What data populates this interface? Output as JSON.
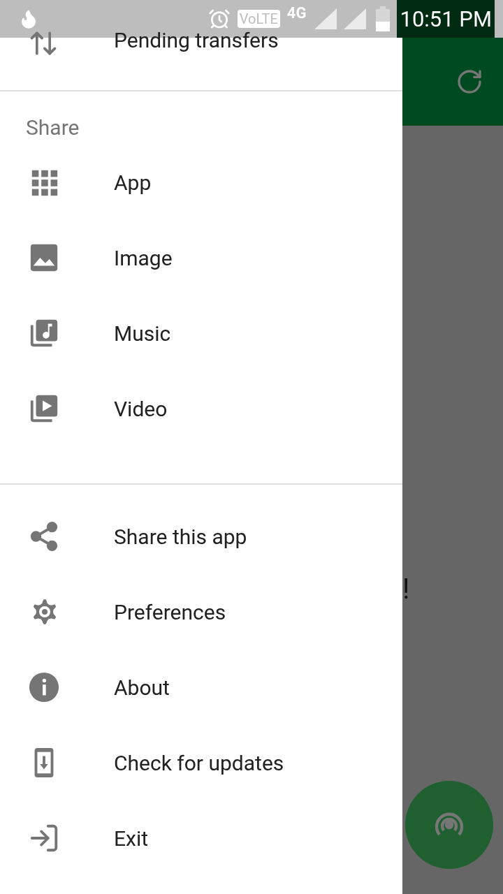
{
  "status_bar": {
    "volte": "VoLTE",
    "network": "4G",
    "time": "10:51 PM"
  },
  "drawer": {
    "top_item": {
      "label": "Pending transfers",
      "kind": "transfers"
    },
    "sections": [
      {
        "header": "Share",
        "items": [
          {
            "label": "App",
            "kind": "apps"
          },
          {
            "label": "Image",
            "kind": "image"
          },
          {
            "label": "Music",
            "kind": "music"
          },
          {
            "label": "Video",
            "kind": "video"
          }
        ]
      },
      {
        "items": [
          {
            "label": "Share this app",
            "kind": "share"
          },
          {
            "label": "Preferences",
            "kind": "settings"
          },
          {
            "label": "About",
            "kind": "info"
          },
          {
            "label": "Check for updates",
            "kind": "update"
          },
          {
            "label": "Exit",
            "kind": "exit"
          }
        ]
      }
    ]
  },
  "background": {
    "text": "!"
  }
}
